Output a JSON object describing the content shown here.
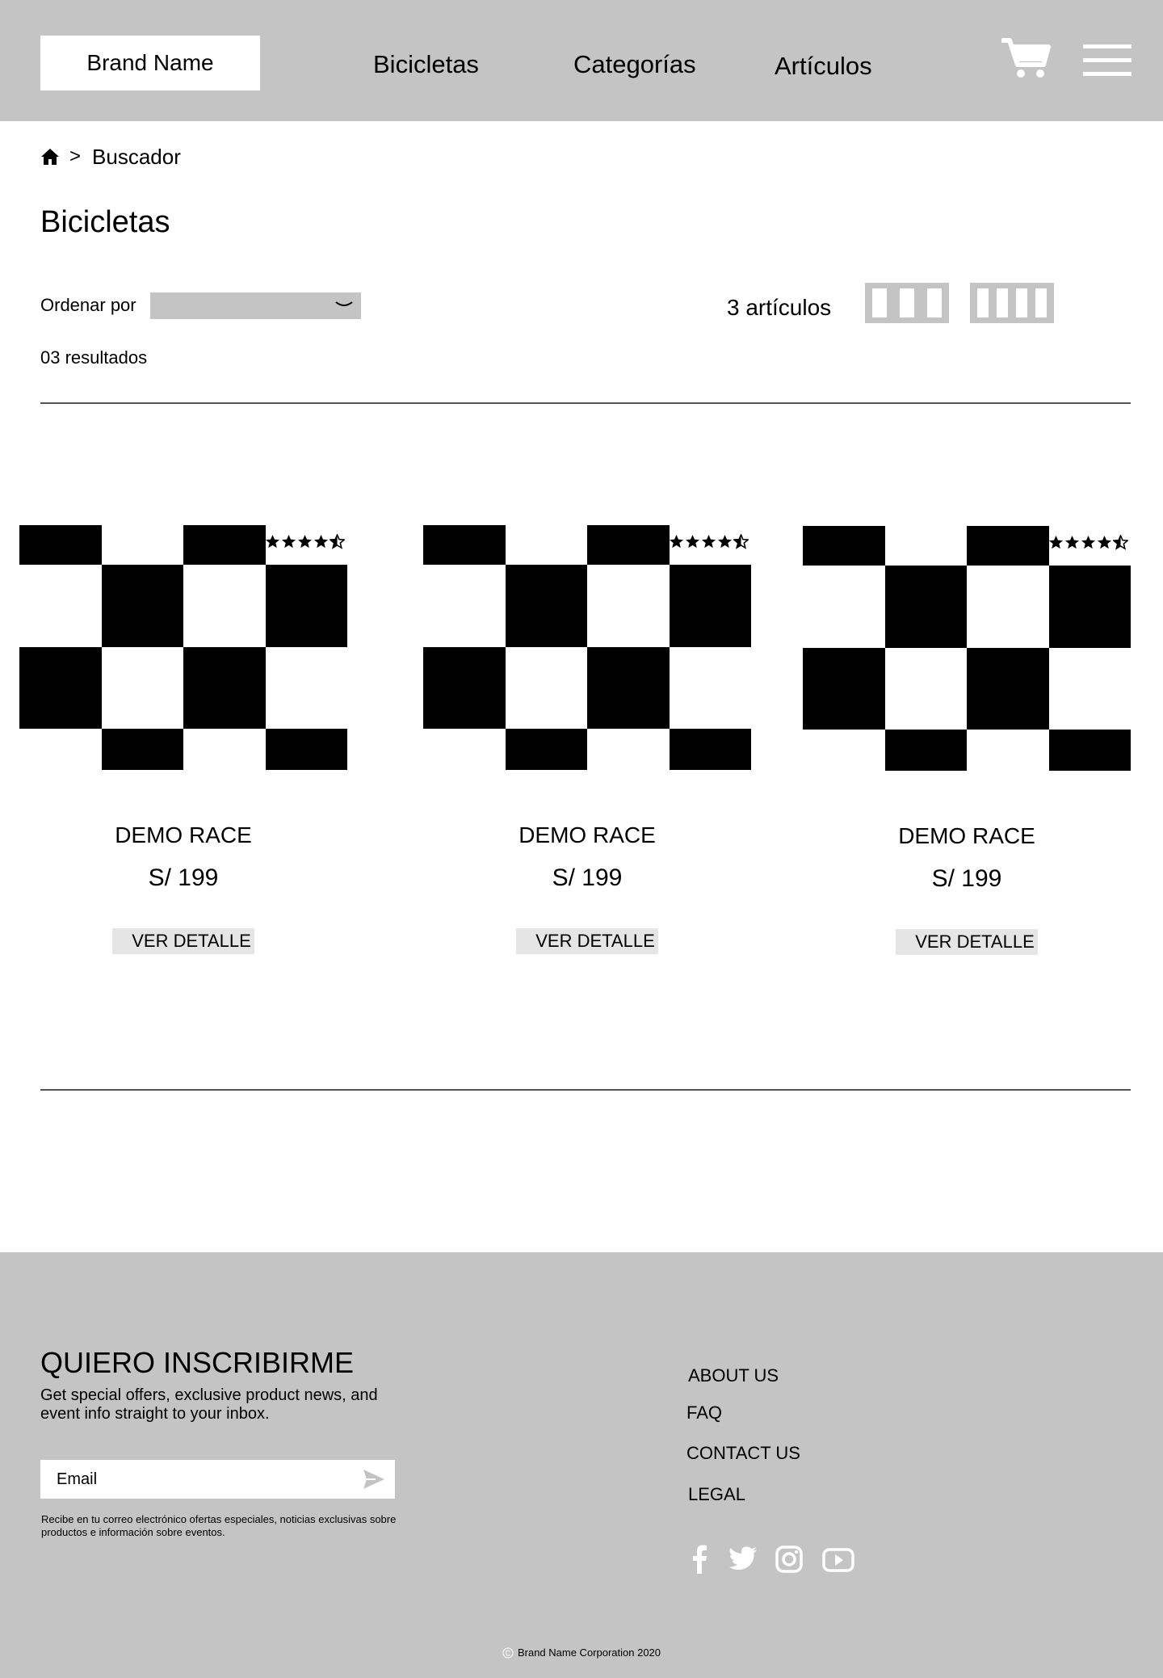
{
  "header": {
    "brand": "Brand Name",
    "nav": [
      "Bicicletas",
      "Categorías",
      "Artículos"
    ],
    "cart_icon": "cart-icon",
    "menu_icon": "hamburger-menu-icon"
  },
  "breadcrumb": {
    "home_icon": "home-icon",
    "separator": ">",
    "current": "Buscador"
  },
  "page": {
    "title": "Bicicletas",
    "sort_label": "Ordenar por",
    "sort_value": "",
    "results": "03 resultados",
    "count_label": "3 artículos",
    "view_options": [
      "3-columns",
      "4-columns"
    ]
  },
  "products": [
    {
      "name": "DEMO RACE",
      "price": "S/ 199",
      "button": "VER DETALLE",
      "rating": 4.5
    },
    {
      "name": "DEMO RACE",
      "price": "S/ 199",
      "button": "VER DETALLE",
      "rating": 4.5
    },
    {
      "name": "DEMO RACE",
      "price": "S/ 199",
      "button": "VER DETALLE",
      "rating": 4.5
    }
  ],
  "footer": {
    "title": "QUIERO INSCRIBIRME",
    "description": "Get special offers, exclusive product news, and event info straight to your inbox.",
    "email_placeholder": "Email",
    "note": "Recibe en tu correo electrónico ofertas especiales, noticias exclusivas sobre productos e información sobre eventos.",
    "links": [
      "ABOUT US",
      "FAQ",
      "CONTACT US",
      "LEGAL"
    ],
    "social": [
      "facebook-icon",
      "twitter-icon",
      "instagram-icon",
      "youtube-icon"
    ],
    "copyright": "Brand Name Corporation 2020"
  },
  "colors": {
    "header_bg": "#c4c4c4",
    "footer_bg": "#c4c4c4",
    "button_bg": "#e5e5e5"
  }
}
